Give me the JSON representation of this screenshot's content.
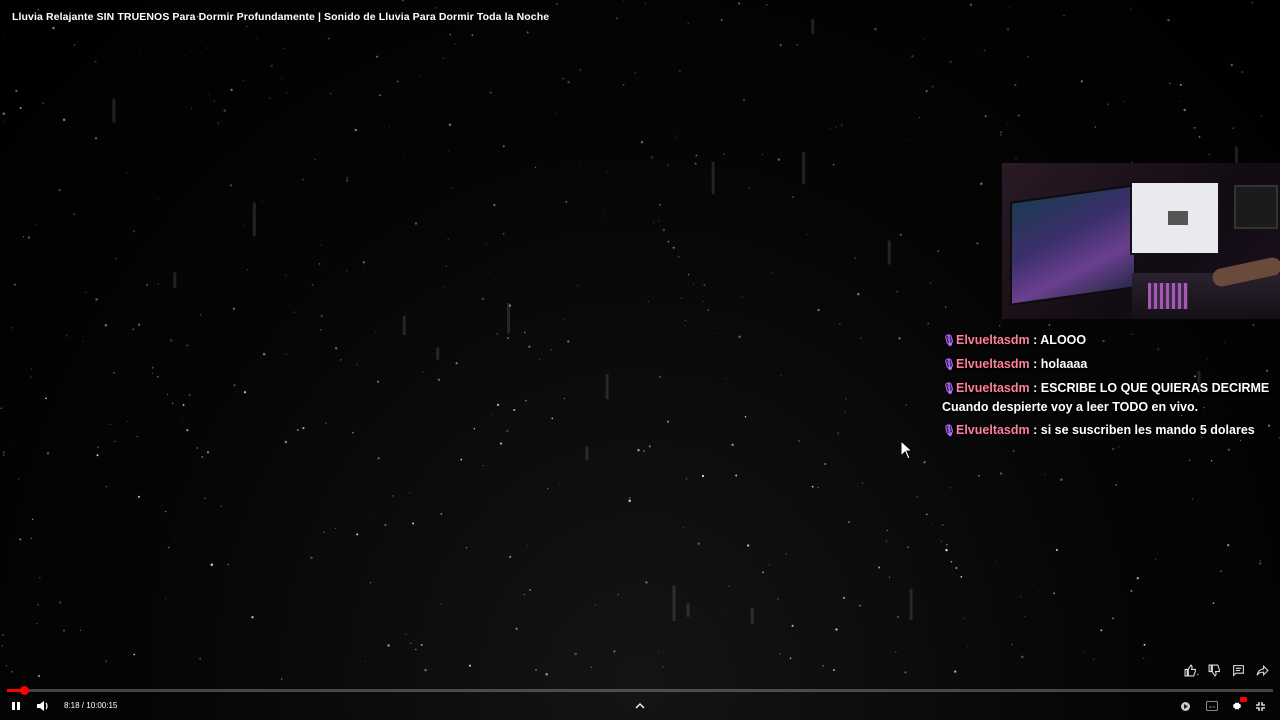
{
  "video": {
    "title": "Lluvia Relajante SIN TRUENOS Para Dormir Profundamente | Sonido de Lluvia Para Dormir Toda la Noche"
  },
  "chat": {
    "messages": [
      {
        "user": "Elvueltasdm",
        "text": " : ALOOO"
      },
      {
        "user": "Elvueltasdm",
        "text": " : holaaaa"
      },
      {
        "user": "Elvueltasdm",
        "text": " : ESCRIBE LO QUE QUIERAS DECIRME Cuando despierte voy a leer TODO en vivo."
      },
      {
        "user": "Elvueltasdm",
        "text": " : si se suscriben les mando 5 dolares"
      }
    ],
    "icon": "microphone-icon",
    "username_color": "#ff7f9e",
    "icon_color": "#b36bff"
  },
  "player": {
    "time_display": "8:18 / 10:00:15",
    "progress_fraction": 0.0138,
    "accent_color": "#ff0000",
    "icons": {
      "play_pause": "pause-icon",
      "volume": "volume-icon",
      "expand": "chevron-up-icon",
      "autoplay": "autoplay-toggle-icon",
      "subtitles": "subtitles-icon",
      "settings": "gear-icon",
      "exit_fullscreen": "exit-fullscreen-icon"
    }
  },
  "side_actions": [
    "like-icon",
    "dislike-icon",
    "comment-icon",
    "share-icon"
  ]
}
